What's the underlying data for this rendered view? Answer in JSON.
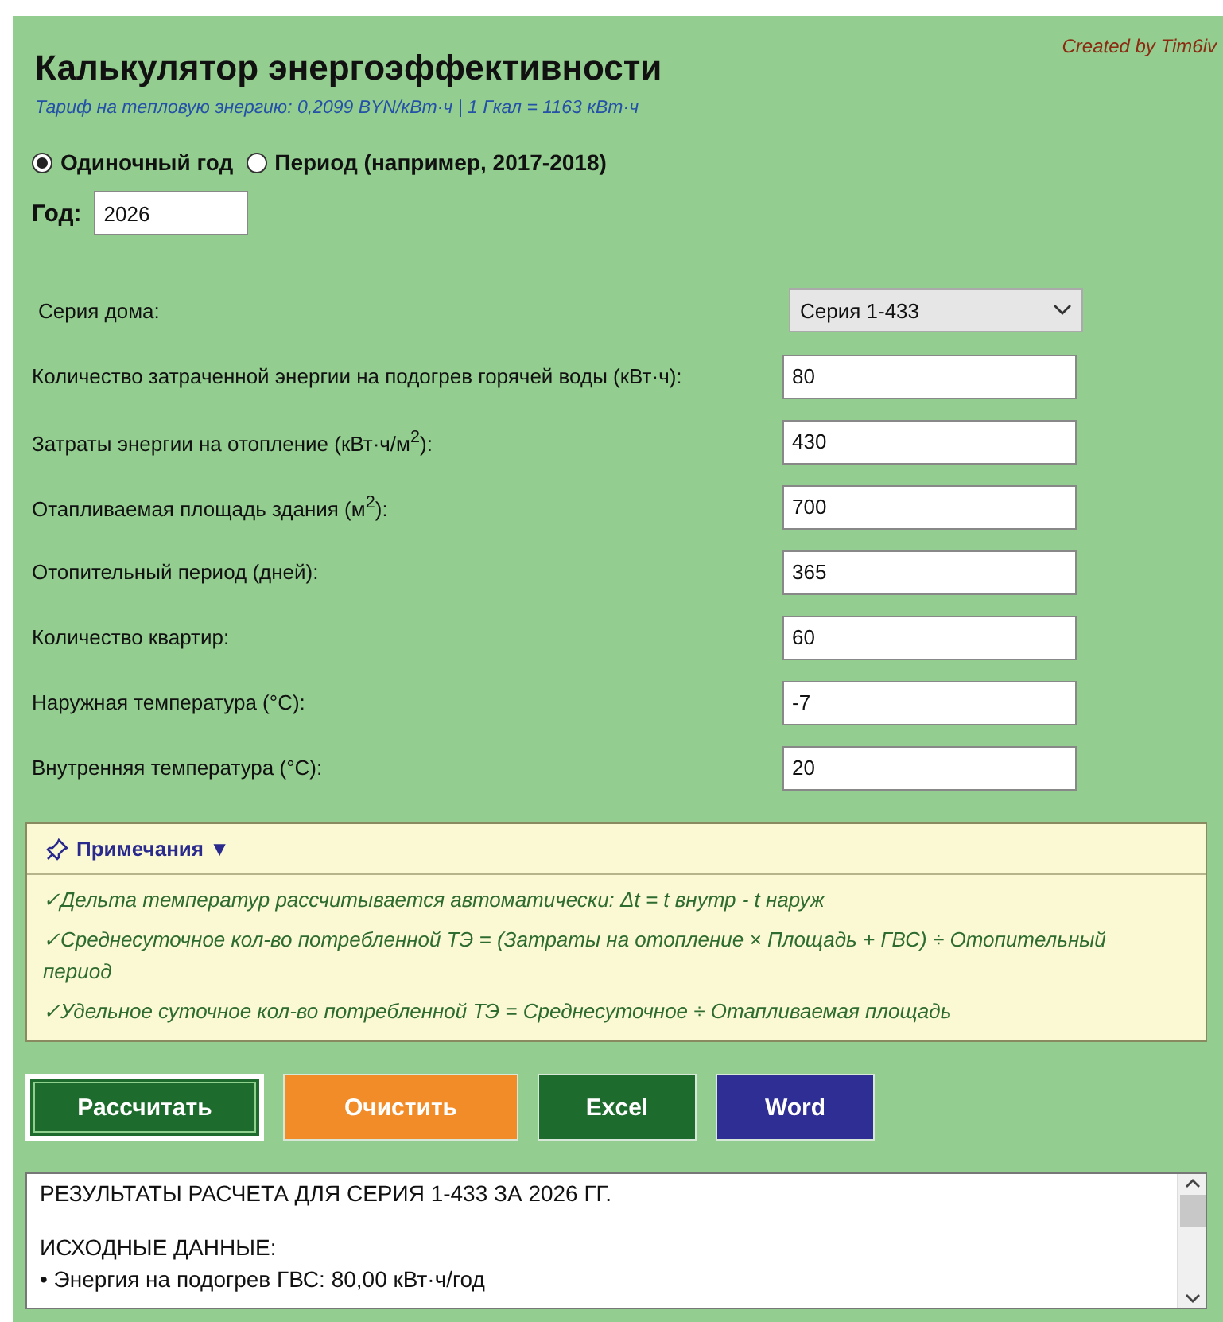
{
  "header": {
    "title": "Калькулятор энергоэффективности",
    "subtitle": "Тариф на тепловую энергию: 0,2099 BYN/кВт·ч | 1 Гкал = 1163 кВт·ч",
    "credit": "Created by Tim6iv"
  },
  "mode": [
    {
      "label": "Одиночный год",
      "selected": true
    },
    {
      "label": "Период (например, 2017-2018)",
      "selected": false
    }
  ],
  "year": {
    "label": "Год:",
    "value": "2026"
  },
  "series": {
    "label": "Серия дома:",
    "value": "Серия 1-433"
  },
  "fields": [
    {
      "label": "Количество затраченной энергии на подогрев горячей воды (кВт·ч):",
      "value": "80"
    },
    {
      "label": "Затраты энергии на отопление (кВт·ч/м$^{2}$):",
      "value": "430"
    },
    {
      "label": "Отапливаемая площадь здания (м$^{2}$):",
      "value": "700"
    },
    {
      "label": "Отопительный период (дней):",
      "value": "365"
    },
    {
      "label": "Количество квартир:",
      "value": "60"
    },
    {
      "label": "Наружная температура (°C):",
      "value": "-7"
    },
    {
      "label": "Внутренняя температура (°C):",
      "value": "20"
    }
  ],
  "notes": {
    "title": "Примечания ▼",
    "expanded": true,
    "items": [
      "✓Дельта температур рассчитывается автоматически: Δt = t внутр - t наруж",
      "✓Среднесуточное кол-во потребленной ТЭ = (Затраты на отопление × Площадь + ГВС) ÷ Отопительный период",
      "✓Удельное суточное кол-во потребленной ТЭ = Среднесуточное ÷ Отапливаемая площадь"
    ]
  },
  "buttons": [
    {
      "label": "Рассчитать",
      "color": "#1e6b2e",
      "focused": true
    },
    {
      "label": "Очистить",
      "color": "#f28c28",
      "focused": false
    },
    {
      "label": "Excel",
      "color": "#1e6b2e",
      "focused": false
    },
    {
      "label": "Word",
      "color": "#2e2e94",
      "focused": false
    }
  ],
  "results": {
    "paragraphs": [
      [
        "РЕЗУЛЬТАТЫ РАСЧЕТА ДЛЯ СЕРИЯ 1-433 ЗА 2026 ГГ."
      ],
      [
        "ИСХОДНЫЕ ДАННЫЕ:",
        "• Энергия на подогрев ГВС: 80,00 кВт·ч/год"
      ]
    ]
  }
}
